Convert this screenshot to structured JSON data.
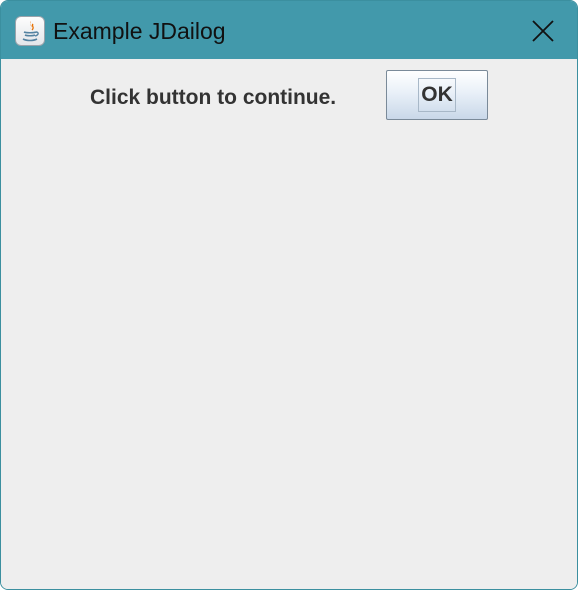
{
  "window": {
    "title": "Example JDailog",
    "app_icon": "java-icon",
    "close_icon": "close-icon"
  },
  "dialog": {
    "message": "Click button to continue.",
    "ok_label": "OK"
  },
  "colors": {
    "titlebar": "#4299ab",
    "content_background": "#eeeeee",
    "text": "#333333"
  }
}
